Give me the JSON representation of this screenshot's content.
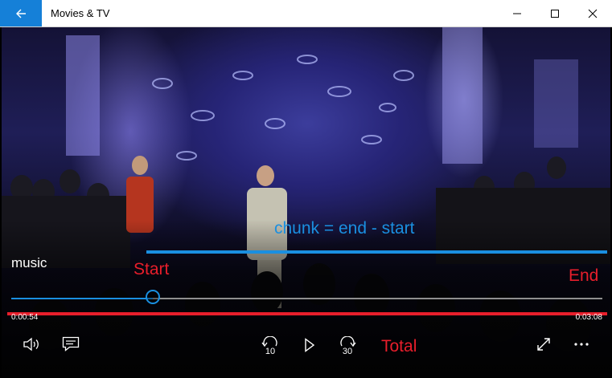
{
  "window": {
    "title": "Movies & TV",
    "back_icon": "back-arrow-icon",
    "minimize_icon": "minimize-icon",
    "maximize_icon": "maximize-icon",
    "close_icon": "close-icon",
    "accent_color": "#1580d8"
  },
  "player": {
    "overlay_title": "music",
    "elapsed_time": "0:00:54",
    "total_time": "0:03:08",
    "progress": 0.24,
    "controls": {
      "volume_icon": "volume-icon",
      "captions_icon": "captions-icon",
      "skip_back_label": "10",
      "skip_back_icon": "skip-back-10-icon",
      "play_icon": "play-icon",
      "skip_forward_label": "30",
      "skip_forward_icon": "skip-forward-30-icon",
      "fullscreen_icon": "fullscreen-icon",
      "more_icon": "more-options-icon"
    }
  },
  "annotations": {
    "chunk_label": "chunk = end - start",
    "start_label": "Start",
    "end_label": "End",
    "total_label": "Total",
    "blue_color": "#1a8fe0",
    "red_color": "#e81e2b"
  }
}
